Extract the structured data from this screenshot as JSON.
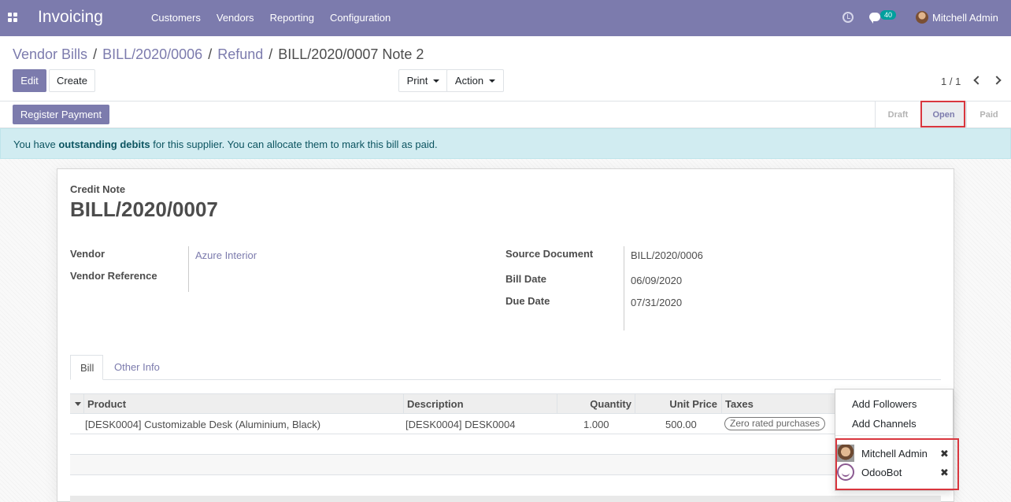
{
  "navbar": {
    "app_name": "Invoicing",
    "menu": [
      "Customers",
      "Vendors",
      "Reporting",
      "Configuration"
    ],
    "chat_count": "40",
    "user_name": "Mitchell Admin"
  },
  "breadcrumb": {
    "items": [
      "Vendor Bills",
      "BILL/2020/0006",
      "Refund"
    ],
    "current": "BILL/2020/0007 Note 2"
  },
  "buttons": {
    "edit": "Edit",
    "create": "Create",
    "print": "Print",
    "action": "Action"
  },
  "pager": {
    "value": "1 / 1"
  },
  "statusbar": {
    "register_payment": "Register Payment",
    "steps": [
      "Draft",
      "Open",
      "Paid"
    ],
    "active_step": "Open"
  },
  "alert": {
    "prefix": "You have ",
    "bold": "outstanding debits",
    "suffix": " for this supplier. You can allocate them to mark this bill as paid."
  },
  "form": {
    "doc_type": "Credit Note",
    "name": "BILL/2020/0007",
    "vendor_label": "Vendor",
    "vendor_value": "Azure Interior",
    "vendor_ref_label": "Vendor Reference",
    "source_doc_label": "Source Document",
    "source_doc_value": "BILL/2020/0006",
    "bill_date_label": "Bill Date",
    "bill_date_value": "06/09/2020",
    "due_date_label": "Due Date",
    "due_date_value": "07/31/2020"
  },
  "tabs": [
    "Bill",
    "Other Info"
  ],
  "table": {
    "columns": [
      "Product",
      "Description",
      "Quantity",
      "Unit Price",
      "Taxes"
    ],
    "rows": [
      {
        "product": "[DESK0004] Customizable Desk (Aluminium, Black)",
        "description": "[DESK0004] DESK0004",
        "quantity": "1.000",
        "unit_price": "500.00",
        "tax": "Zero rated purchases"
      }
    ]
  },
  "followers_dropdown": {
    "add_followers": "Add Followers",
    "add_channels": "Add Channels",
    "followers": [
      "Mitchell Admin",
      "OdooBot"
    ],
    "remove_glyph": "✖"
  },
  "colors": {
    "brand": "#7c7bad",
    "highlight": "#d9363e",
    "alert_bg": "#d1ecf1"
  }
}
